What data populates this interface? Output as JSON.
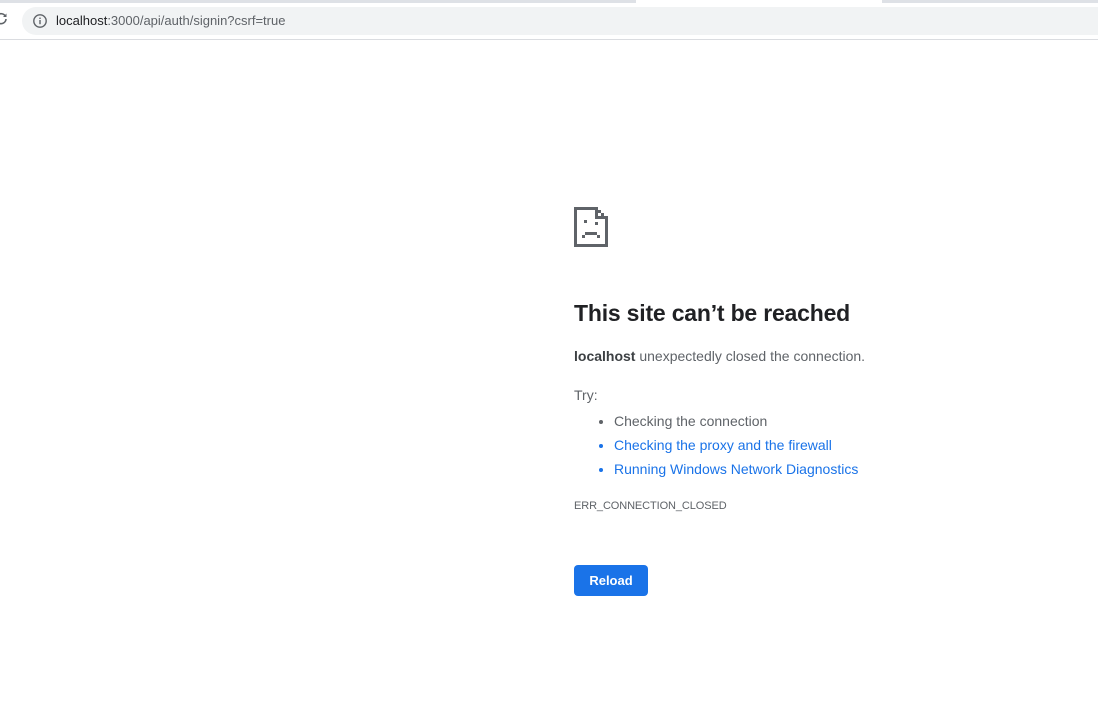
{
  "browser": {
    "url_host": "localhost",
    "url_rest": ":3000/api/auth/signin?csrf=true"
  },
  "error_page": {
    "heading": "This site can’t be reached",
    "summary_host": "localhost",
    "summary_text": " unexpectedly closed the connection.",
    "try_label": "Try:",
    "suggestions": [
      "Checking the connection",
      "Checking the proxy and the firewall",
      "Running Windows Network Diagnostics"
    ],
    "error_code": "ERR_CONNECTION_CLOSED",
    "reload_label": "Reload"
  },
  "colors": {
    "accent": "#1a73e8",
    "heading": "#202124",
    "body_text": "#5f6368",
    "omnibox_bg": "#f1f3f4"
  },
  "icons": {
    "toolbar_reload": "reload-icon",
    "site_info": "info-icon",
    "error": "sad-page-icon"
  }
}
